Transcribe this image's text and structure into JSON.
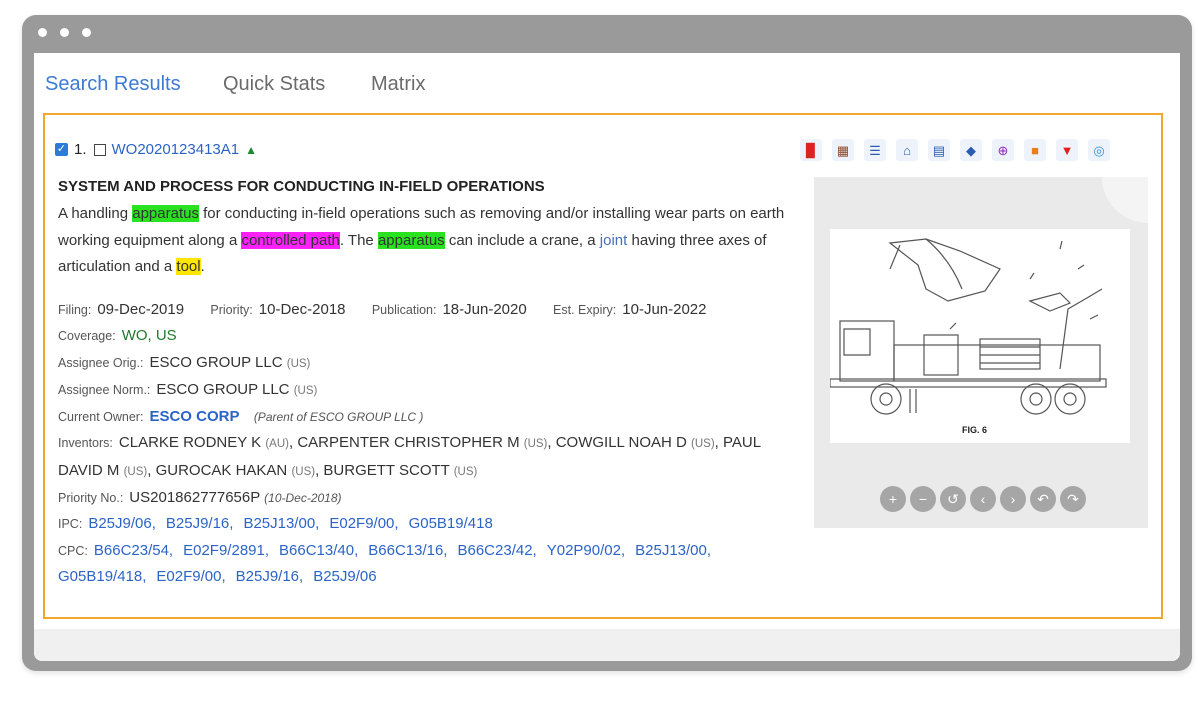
{
  "tabs": [
    {
      "label": "Search Results",
      "active": true
    },
    {
      "label": "Quick Stats",
      "active": false
    },
    {
      "label": "Matrix",
      "active": false
    }
  ],
  "result": {
    "index": "1.",
    "pub_number": "WO2020123413A1",
    "title": "SYSTEM AND PROCESS FOR CONDUCTING IN-FIELD OPERATIONS",
    "abstract": {
      "t1": "A handling ",
      "h1": "apparatus",
      "t2": " for conducting in-field operations such as removing and/or installing wear parts on earth working equipment along a ",
      "h2": "controlled path",
      "t3": ". The ",
      "h3": "apparatus",
      "t4": " can include a crane, a ",
      "joint": "joint",
      "t5": " having three axes of articulation and a ",
      "h4": "tool",
      "t6": "."
    },
    "filing_label": "Filing:",
    "filing": "09-Dec-2019",
    "priority_label": "Priority:",
    "priority": "10-Dec-2018",
    "publication_label": "Publication:",
    "publication": "18-Jun-2020",
    "expiry_label": "Est. Expiry:",
    "expiry": "10-Jun-2022",
    "coverage_label": "Coverage:",
    "coverage": "WO, US",
    "assignee_orig_label": "Assignee Orig.:",
    "assignee_orig": "ESCO GROUP LLC",
    "assignee_norm_label": "Assignee Norm.:",
    "assignee_norm": "ESCO GROUP LLC",
    "country_us": "(US)",
    "current_owner_label": "Current Owner:",
    "current_owner": "ESCO CORP",
    "current_owner_parent": "(Parent of ESCO GROUP LLC )",
    "inventors_label": "Inventors:",
    "inventors": [
      {
        "name": "CLARKE RODNEY K",
        "cc": "(AU)"
      },
      {
        "name": "CARPENTER CHRISTOPHER M",
        "cc": "(US)"
      },
      {
        "name": "COWGILL NOAH D",
        "cc": "(US)"
      },
      {
        "name": "PAUL DAVID M",
        "cc": "(US)"
      },
      {
        "name": "GUROCAK HAKAN",
        "cc": "(US)"
      },
      {
        "name": "BURGETT SCOTT",
        "cc": "(US)"
      }
    ],
    "priority_no_label": "Priority No.:",
    "priority_no": "US201862777656P",
    "priority_no_date": "(10-Dec-2018)",
    "ipc_label": "IPC:",
    "ipc": [
      "B25J9/06,",
      "B25J9/16,",
      "B25J13/00,",
      "E02F9/00,",
      "G05B19/418"
    ],
    "cpc_label": "CPC:",
    "cpc_line1": [
      "B66C23/54,",
      "E02F9/2891,",
      "B66C13/40,",
      "B66C13/16,",
      "B66C23/42,",
      "Y02P90/02,",
      "B25J13/00,"
    ],
    "cpc_line2": [
      "G05B19/418,",
      "E02F9/00,",
      "B25J9/16,",
      "B25J9/06"
    ],
    "figure_caption": "FIG. 6"
  },
  "toolbar_icons": [
    "pdf-icon",
    "qr-code-icon",
    "document-list-icon",
    "institution-icon",
    "table-icon",
    "tag-icon",
    "target-icon",
    "folder-icon",
    "cart-icon",
    "shield-icon"
  ],
  "image_controls": [
    "zoom-in-icon",
    "zoom-out-icon",
    "reset-icon",
    "previous-icon",
    "next-icon",
    "rotate-left-icon",
    "rotate-right-icon"
  ]
}
